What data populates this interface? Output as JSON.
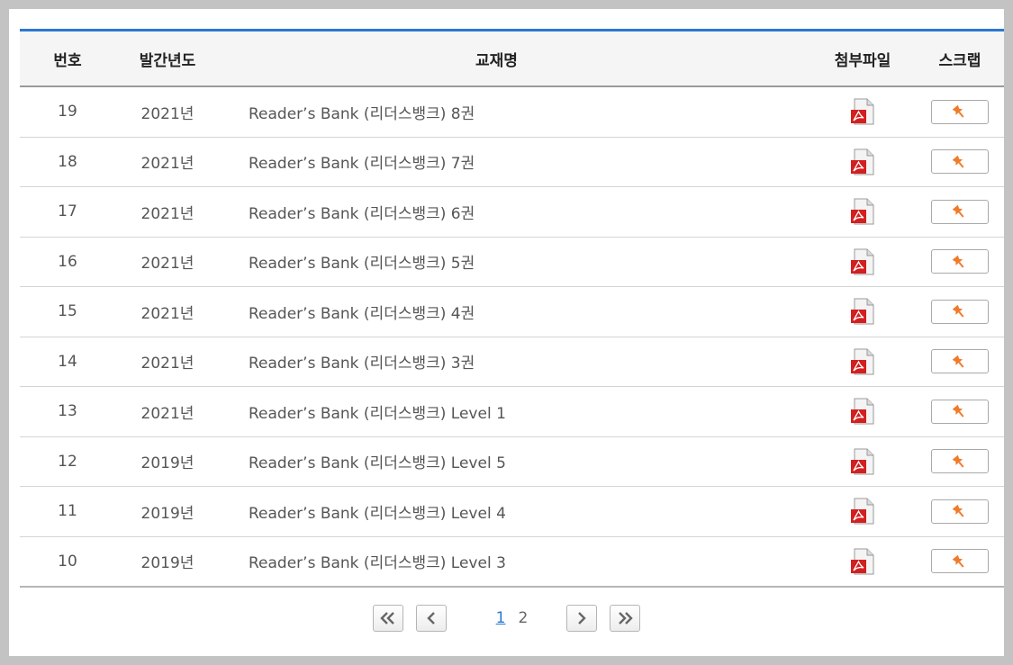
{
  "table": {
    "headers": {
      "no": "번호",
      "year": "발간년도",
      "title": "교재명",
      "file": "첨부파일",
      "scrap": "스크랩"
    },
    "rows": [
      {
        "no": "19",
        "year": "2021년",
        "title": "Reader’s Bank (리더스뱅크) 8권"
      },
      {
        "no": "18",
        "year": "2021년",
        "title": "Reader’s Bank (리더스뱅크) 7권"
      },
      {
        "no": "17",
        "year": "2021년",
        "title": "Reader’s Bank (리더스뱅크) 6권"
      },
      {
        "no": "16",
        "year": "2021년",
        "title": "Reader’s Bank (리더스뱅크) 5권"
      },
      {
        "no": "15",
        "year": "2021년",
        "title": "Reader’s Bank (리더스뱅크) 4권"
      },
      {
        "no": "14",
        "year": "2021년",
        "title": "Reader’s Bank (리더스뱅크) 3권"
      },
      {
        "no": "13",
        "year": "2021년",
        "title": "Reader’s Bank (리더스뱅크) Level 1"
      },
      {
        "no": "12",
        "year": "2019년",
        "title": "Reader’s Bank (리더스뱅크) Level 5"
      },
      {
        "no": "11",
        "year": "2019년",
        "title": "Reader’s Bank (리더스뱅크) Level 4"
      },
      {
        "no": "10",
        "year": "2019년",
        "title": "Reader’s Bank (리더스뱅크) Level 3"
      }
    ],
    "file_icon": "pdf-icon",
    "scrap_icon": "pin-icon"
  },
  "pagination": {
    "pages": [
      "1",
      "2"
    ],
    "current": "1",
    "icons": [
      "first-page-icon",
      "prev-page-icon",
      "next-page-icon",
      "last-page-icon"
    ]
  },
  "colors": {
    "accent": "#2a78d0",
    "pdf_red": "#d21f1f",
    "pin_orange": "#f07b2a"
  }
}
